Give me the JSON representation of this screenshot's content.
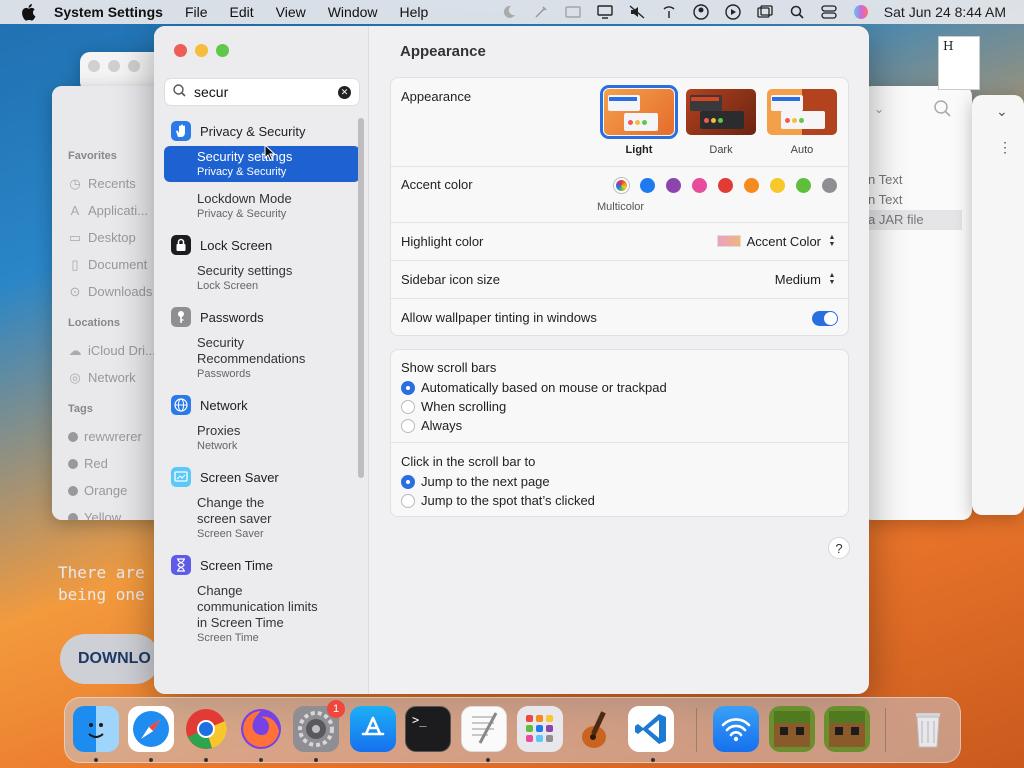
{
  "menubar": {
    "app_name": "System Settings",
    "items": [
      "File",
      "Edit",
      "View",
      "Window",
      "Help"
    ],
    "clock": "Sat Jun 24  8:44 AM"
  },
  "finder": {
    "favorites_label": "Favorites",
    "favorites": [
      "Recents",
      "Applicati...",
      "Desktop",
      "Document",
      "Downloads"
    ],
    "locations_label": "Locations",
    "locations": [
      "iCloud Dri...",
      "Network"
    ],
    "tags_label": "Tags",
    "tags": [
      {
        "name": "rewwrerer",
        "color": "#9a9a9a"
      },
      {
        "name": "Red",
        "color": "#9a9a9a"
      },
      {
        "name": "Orange",
        "color": "#9a9a9a"
      },
      {
        "name": "Yellow",
        "color": "#9a9a9a"
      }
    ]
  },
  "right_window": {
    "items": [
      "n Text",
      "n Text",
      "a JAR file"
    ]
  },
  "website": {
    "line1": "There are n",
    "line2": "being one o",
    "button": "DOWNLO"
  },
  "sidebar": {
    "search_value": "secur",
    "groups": [
      {
        "name": "Privacy & Security",
        "icon": "hand-icon",
        "color": "#2a7ae8",
        "results": [
          {
            "title": "Security settings",
            "subtitle": "Privacy & Security",
            "selected": true
          },
          {
            "title": "Lockdown Mode",
            "subtitle": "Privacy & Security",
            "selected": false
          }
        ]
      },
      {
        "name": "Lock Screen",
        "icon": "lock-icon",
        "color": "#1c1c1e",
        "results": [
          {
            "title": "Security settings",
            "subtitle": "Lock Screen",
            "selected": false
          }
        ]
      },
      {
        "name": "Passwords",
        "icon": "key-icon",
        "color": "#8e8e93",
        "results": [
          {
            "title": "Security\nRecommendations",
            "subtitle": "Passwords",
            "selected": false
          }
        ]
      },
      {
        "name": "Network",
        "icon": "globe-icon",
        "color": "#2a7ae8",
        "results": [
          {
            "title": "Proxies",
            "subtitle": "Network",
            "selected": false
          }
        ]
      },
      {
        "name": "Screen Saver",
        "icon": "screensaver-icon",
        "color": "#5ac8fa",
        "results": [
          {
            "title": "Change the\nscreen saver",
            "subtitle": "Screen Saver",
            "selected": false
          }
        ]
      },
      {
        "name": "Screen Time",
        "icon": "hourglass-icon",
        "color": "#5e5ce6",
        "results": [
          {
            "title": "Change\ncommunication limits\nin Screen Time",
            "subtitle": "Screen Time",
            "selected": false
          }
        ]
      }
    ]
  },
  "content": {
    "title": "Appearance",
    "appearance": {
      "label": "Appearance",
      "options": [
        {
          "name": "Light",
          "selected": true
        },
        {
          "name": "Dark",
          "selected": false
        },
        {
          "name": "Auto",
          "selected": false
        }
      ]
    },
    "accent": {
      "label": "Accent color",
      "selected_label": "Multicolor",
      "colors": [
        "multicolor",
        "#1f7af0",
        "#8e44ad",
        "#e84c9c",
        "#e23b35",
        "#f58a1f",
        "#f7c72b",
        "#5fbf3c",
        "#8e8e93"
      ]
    },
    "highlight": {
      "label": "Highlight color",
      "value": "Accent Color"
    },
    "sidebar_icon": {
      "label": "Sidebar icon size",
      "value": "Medium"
    },
    "tinting": {
      "label": "Allow wallpaper tinting in windows",
      "on": true
    },
    "scroll_bars": {
      "label": "Show scroll bars",
      "options": [
        {
          "label": "Automatically based on mouse or trackpad",
          "selected": true
        },
        {
          "label": "When scrolling",
          "selected": false
        },
        {
          "label": "Always",
          "selected": false
        }
      ]
    },
    "click_scroll": {
      "label": "Click in the scroll bar to",
      "options": [
        {
          "label": "Jump to the next page",
          "selected": true
        },
        {
          "label": "Jump to the spot that’s clicked",
          "selected": false
        }
      ]
    },
    "help": "?"
  },
  "dock": {
    "apps": [
      "finder",
      "safari",
      "chrome",
      "firefox",
      "system-settings",
      "app-store",
      "terminal",
      "textedit",
      "launchpad",
      "garageband",
      "vscode",
      "wifi-utility",
      "minecraft-1",
      "minecraft-2",
      "trash"
    ],
    "settings_badge": "1"
  }
}
